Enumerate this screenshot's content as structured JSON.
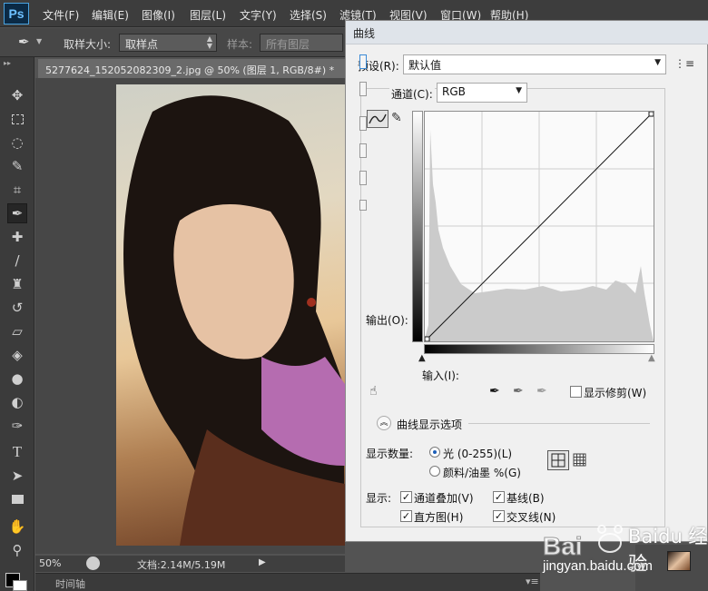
{
  "app": {
    "logo": "Ps"
  },
  "menu": [
    "文件(F)",
    "编辑(E)",
    "图像(I)",
    "图层(L)",
    "文字(Y)",
    "选择(S)",
    "滤镜(T)",
    "视图(V)",
    "窗口(W)",
    "帮助(H)"
  ],
  "options": {
    "sample_size_label": "取样大小:",
    "sample_size_value": "取样点",
    "sample_label": "样本:",
    "sample_value": "所有图层"
  },
  "document": {
    "tab_title": "5277624_152052082309_2.jpg @ 50% (图层 1, RGB/8#) *",
    "zoom": "50%",
    "doc_info": "文档:2.14M/5.19M"
  },
  "timeline": {
    "label": "时间轴"
  },
  "curves": {
    "title": "曲线",
    "preset_label": "预设(R):",
    "preset_value": "默认值",
    "channel_label": "通道(C):",
    "channel_value": "RGB",
    "output_label": "输出(O):",
    "input_label": "输入(I):",
    "show_clipping_label": "显示修剪(W)",
    "display_options_title": "曲线显示选项",
    "show_amount_label": "显示数量:",
    "light_option": "光 (0-255)(L)",
    "pigment_option": "颜料/油墨 %(G)",
    "show_label": "显示:",
    "channel_overlay": "通道叠加(V)",
    "baseline": "基线(B)",
    "histogram": "直方图(H)",
    "intersection": "交叉线(N)",
    "checkbox_states": {
      "show_clipping": false,
      "channel_overlay": true,
      "baseline": true,
      "histogram": true,
      "intersection": true
    },
    "light_selected": true,
    "curve_points": [
      [
        0,
        0
      ],
      [
        255,
        255
      ]
    ]
  },
  "watermark": {
    "brand": "Baidu 经验",
    "url": "jingyan.baidu.com"
  },
  "colors": {
    "accent": "#1d5fb8",
    "menubar": "#3d3d3d",
    "dialog_bg": "#f0f0f0"
  }
}
